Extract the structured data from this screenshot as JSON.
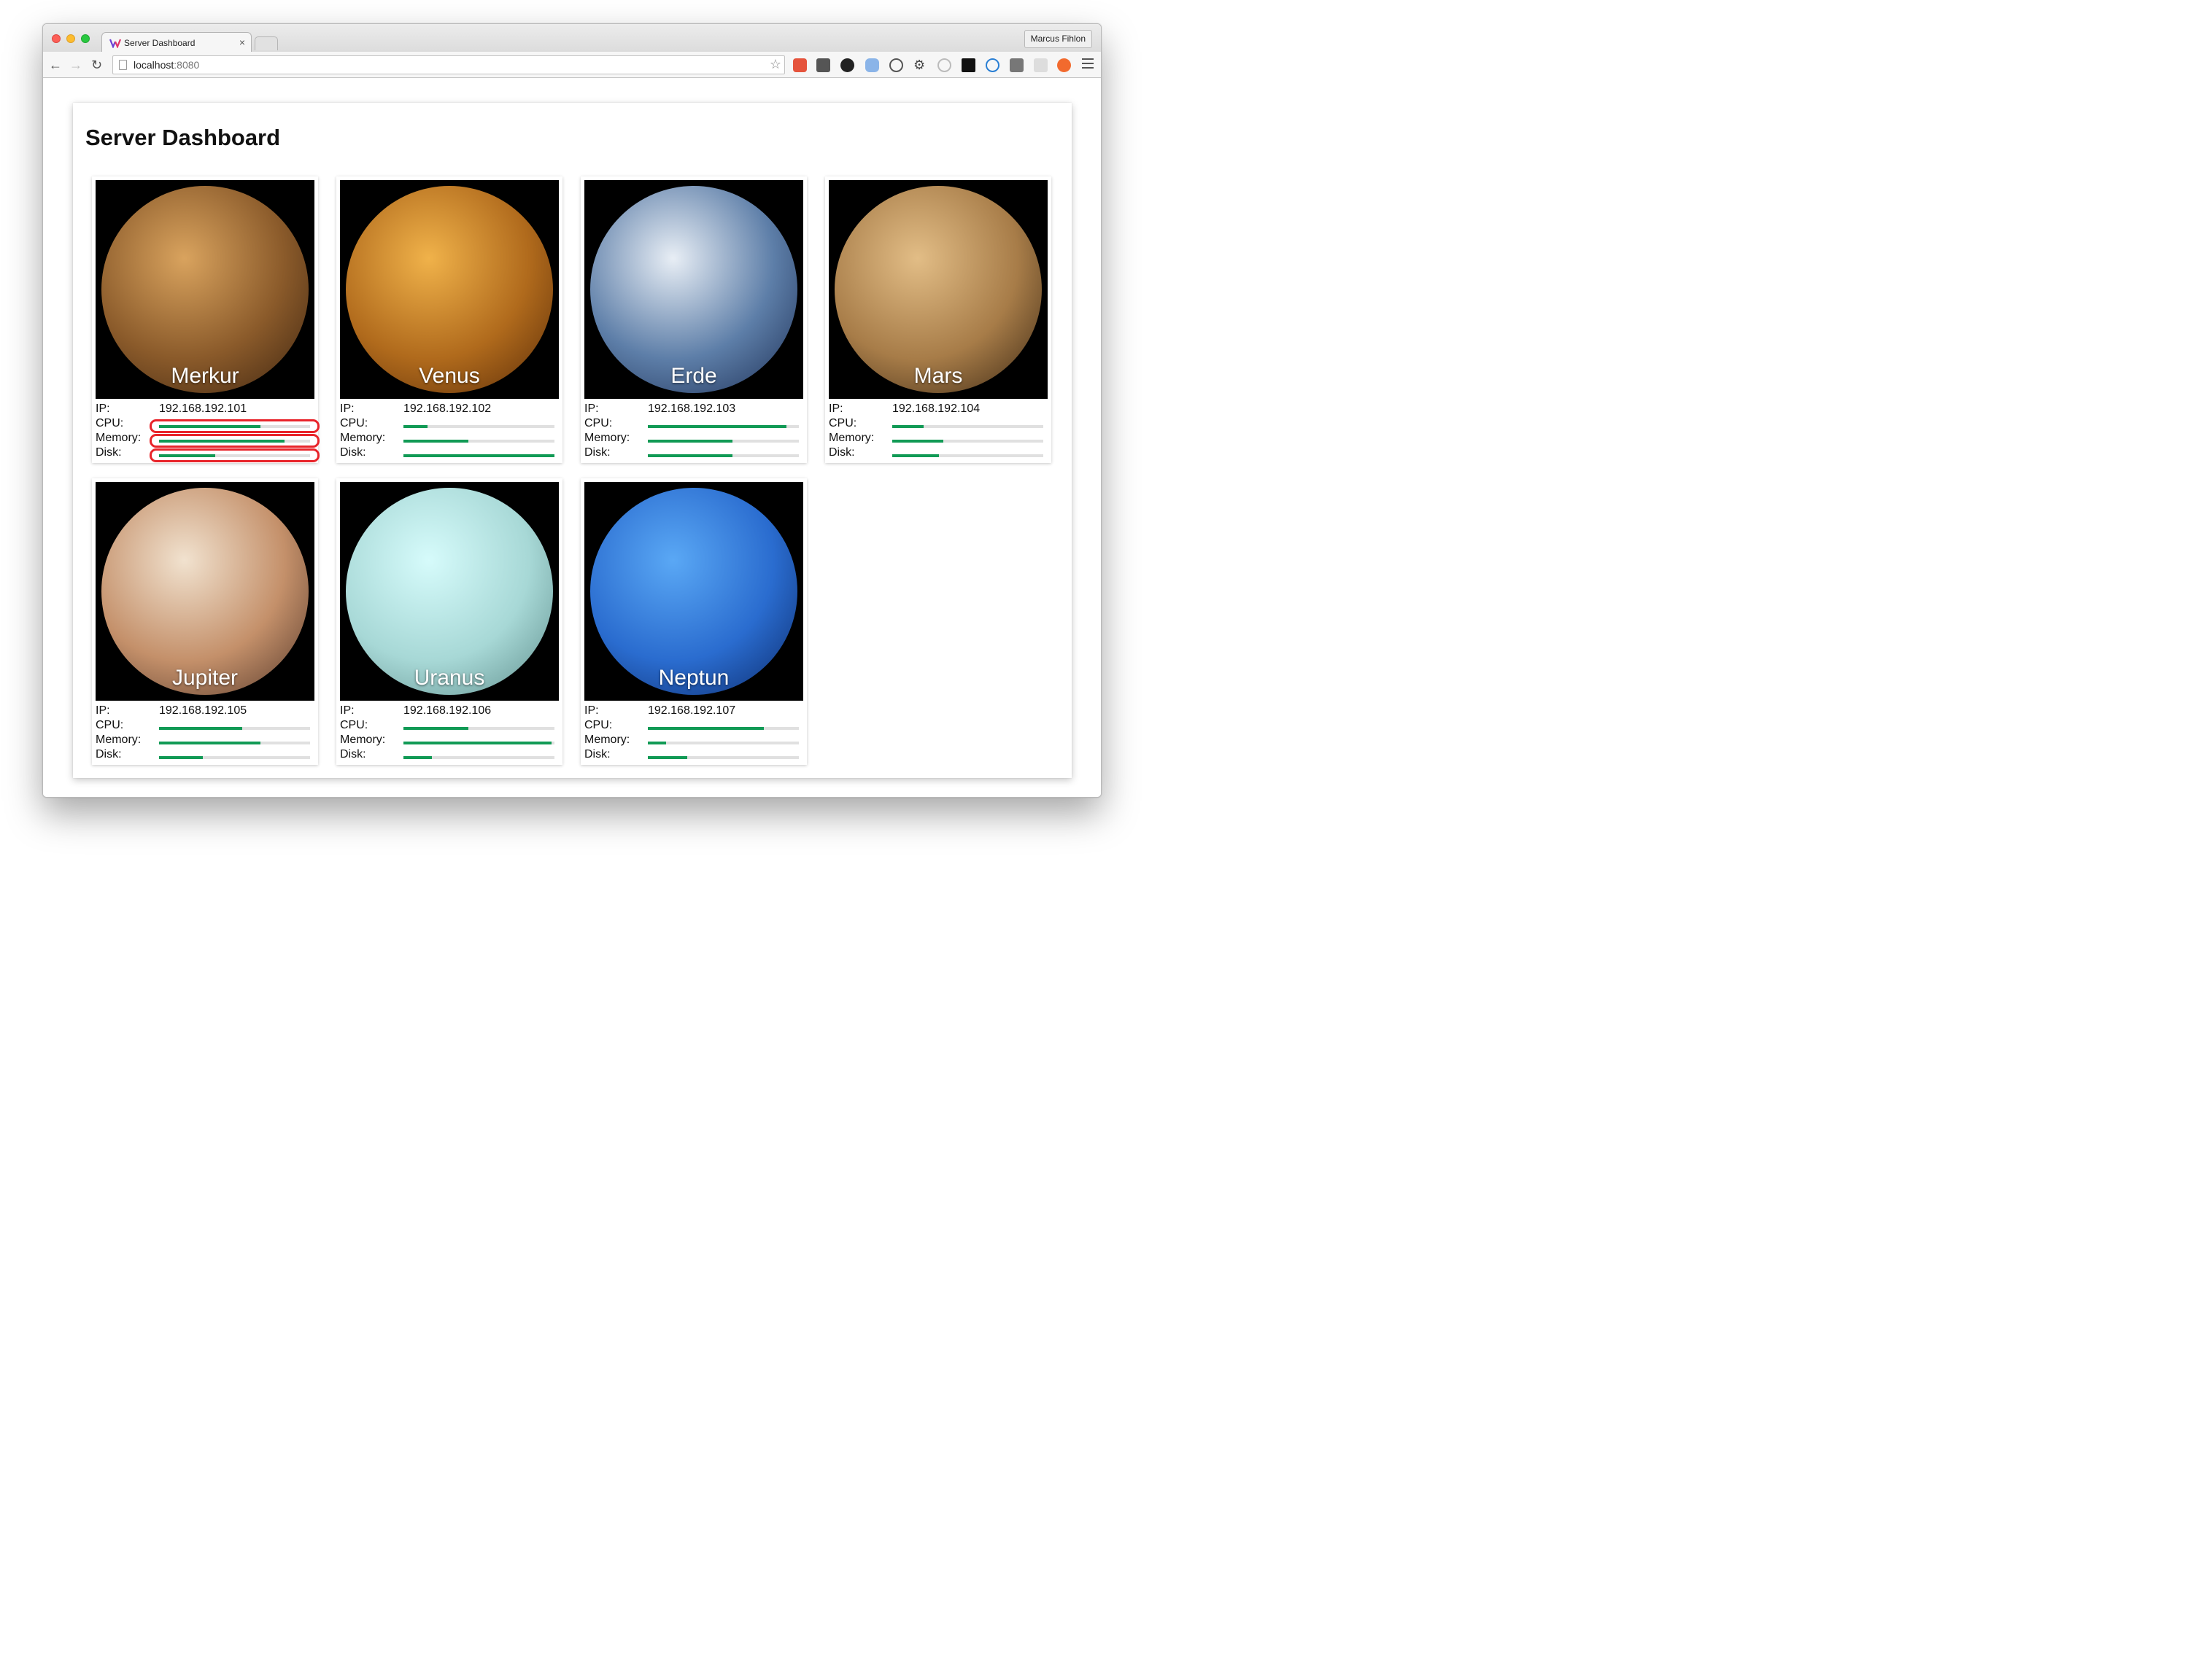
{
  "browser": {
    "tab_title": "Server Dashboard",
    "tab_close": "×",
    "profile_name": "Marcus Fihlon",
    "url_host": "localhost",
    "url_port": ":8080"
  },
  "page": {
    "title": "Server Dashboard",
    "labels": {
      "ip": "IP:",
      "cpu": "CPU:",
      "memory": "Memory:",
      "disk": "Disk:"
    }
  },
  "servers": [
    {
      "name": "Merkur",
      "ip": "192.168.192.101",
      "cpu": 0.67,
      "memory": 0.83,
      "disk": 0.37,
      "highlighted": true,
      "colors": [
        "#d9a35e",
        "#8a5a2a",
        "#3d2410"
      ]
    },
    {
      "name": "Venus",
      "ip": "192.168.192.102",
      "cpu": 0.16,
      "memory": 0.43,
      "disk": 1.0,
      "highlighted": false,
      "colors": [
        "#f0b24a",
        "#b06a1c",
        "#5a2c08"
      ]
    },
    {
      "name": "Erde",
      "ip": "192.168.192.103",
      "cpu": 0.92,
      "memory": 0.56,
      "disk": 0.56,
      "highlighted": false,
      "colors": [
        "#e8eef5",
        "#5d7ea8",
        "#1d2f55"
      ]
    },
    {
      "name": "Mars",
      "ip": "192.168.192.104",
      "cpu": 0.21,
      "memory": 0.34,
      "disk": 0.31,
      "highlighted": false,
      "colors": [
        "#e2bd86",
        "#a77c48",
        "#3a2612"
      ]
    },
    {
      "name": "Jupiter",
      "ip": "192.168.192.105",
      "cpu": 0.55,
      "memory": 0.67,
      "disk": 0.29,
      "highlighted": false,
      "colors": [
        "#f1e2cf",
        "#c4906a",
        "#55382a"
      ]
    },
    {
      "name": "Uranus",
      "ip": "192.168.192.106",
      "cpu": 0.43,
      "memory": 0.98,
      "disk": 0.19,
      "highlighted": false,
      "colors": [
        "#d6fbfb",
        "#a7d8d6",
        "#5e8d8b"
      ]
    },
    {
      "name": "Neptun",
      "ip": "192.168.192.107",
      "cpu": 0.77,
      "memory": 0.12,
      "disk": 0.26,
      "highlighted": false,
      "colors": [
        "#5aa8f5",
        "#2a6ccf",
        "#0c2a6a"
      ]
    }
  ]
}
